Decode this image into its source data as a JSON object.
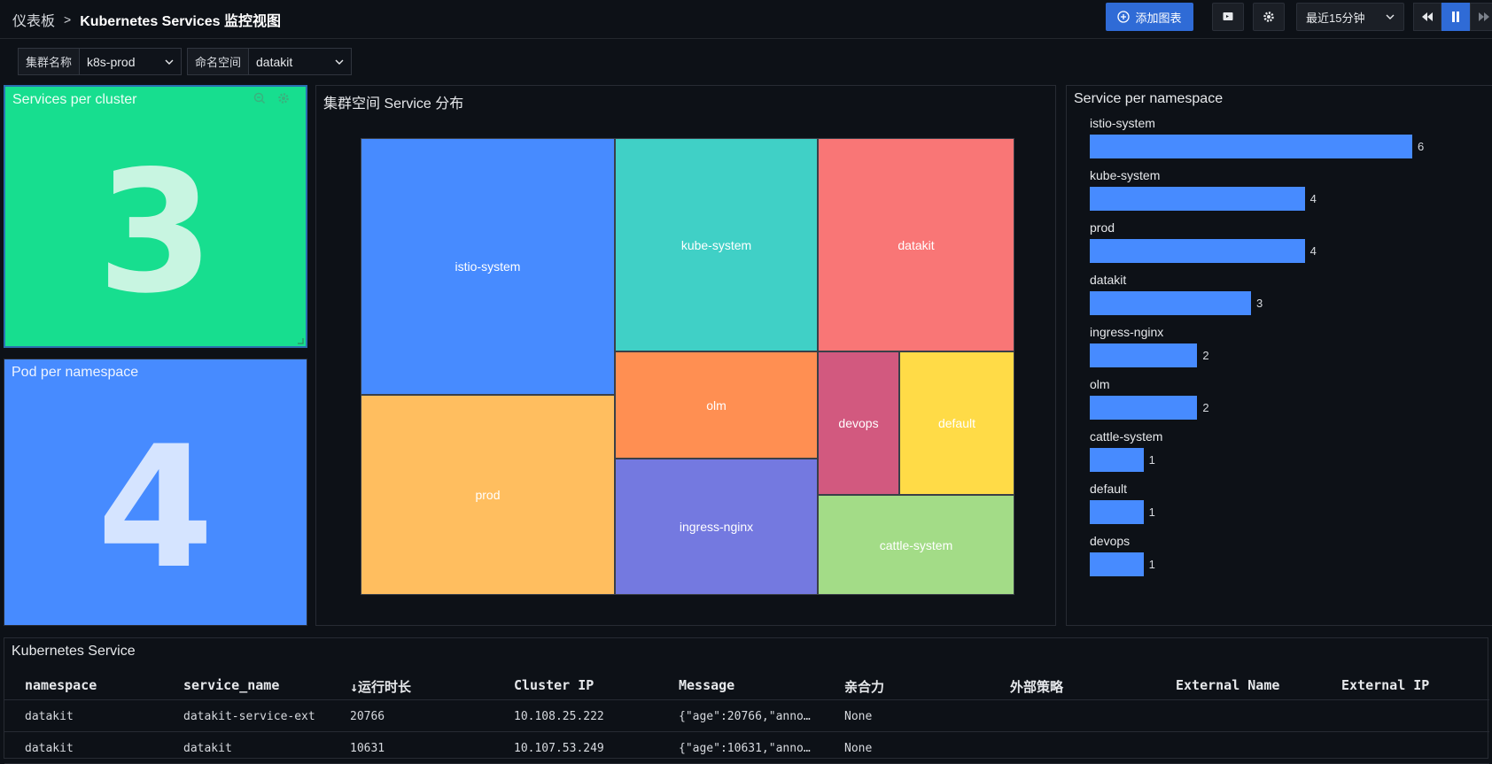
{
  "header": {
    "breadcrumb_root": "仪表板",
    "separator": ">",
    "title": "Kubernetes Services 监控视图",
    "add_chart_label": "添加图表",
    "time_range": "最近15分钟"
  },
  "filters": [
    {
      "label": "集群名称",
      "value": "k8s-prod"
    },
    {
      "label": "命名空间",
      "value": "datakit"
    }
  ],
  "panels": {
    "services_per_cluster": {
      "title": "Services per cluster",
      "value": "3",
      "bg": "#17de8f",
      "fg": "#c8f5e1"
    },
    "pod_per_namespace": {
      "title": "Pod per namespace",
      "value": "4",
      "bg": "#478bff",
      "fg": "#d5e4ff"
    },
    "treemap": {
      "title": "集群空间 Service 分布",
      "cells": [
        {
          "name": "istio-system",
          "color": "#478bff"
        },
        {
          "name": "kube-system",
          "color": "#40d0c6"
        },
        {
          "name": "datakit",
          "color": "#f97676"
        },
        {
          "name": "prod",
          "color": "#ffbe5f"
        },
        {
          "name": "olm",
          "color": "#ff8f52"
        },
        {
          "name": "devops",
          "color": "#d2597f"
        },
        {
          "name": "default",
          "color": "#ffdb47"
        },
        {
          "name": "ingress-nginx",
          "color": "#7479e0"
        },
        {
          "name": "cattle-system",
          "color": "#a3dc87"
        }
      ]
    },
    "service_per_namespace": {
      "title": "Service per namespace",
      "bars": [
        {
          "name": "istio-system",
          "value": 6
        },
        {
          "name": "kube-system",
          "value": 4
        },
        {
          "name": "prod",
          "value": 4
        },
        {
          "name": "datakit",
          "value": 3
        },
        {
          "name": "ingress-nginx",
          "value": 2
        },
        {
          "name": "olm",
          "value": 2
        },
        {
          "name": "cattle-system",
          "value": 1
        },
        {
          "name": "default",
          "value": 1
        },
        {
          "name": "devops",
          "value": 1
        }
      ]
    }
  },
  "chart_data": {
    "type": "bar",
    "categories": [
      "istio-system",
      "kube-system",
      "prod",
      "datakit",
      "ingress-nginx",
      "olm",
      "cattle-system",
      "default",
      "devops"
    ],
    "values": [
      6,
      4,
      4,
      3,
      2,
      2,
      1,
      1,
      1
    ],
    "title": "Service per namespace",
    "orientation": "horizontal",
    "xlim": [
      0,
      6
    ]
  },
  "table": {
    "title": "Kubernetes Service",
    "columns": [
      "namespace",
      "service_name",
      "↓运行时长",
      "Cluster IP",
      "Message",
      "亲合力",
      "外部策略",
      "External Name",
      "External IP"
    ],
    "rows": [
      [
        "datakit",
        "datakit-service-ext",
        "20766",
        "10.108.25.222",
        "{\"age\":20766,\"anno…",
        "None",
        "",
        "",
        ""
      ],
      [
        "datakit",
        "datakit",
        "10631",
        "10.107.53.249",
        "{\"age\":10631,\"anno…",
        "None",
        "",
        "",
        ""
      ]
    ]
  }
}
